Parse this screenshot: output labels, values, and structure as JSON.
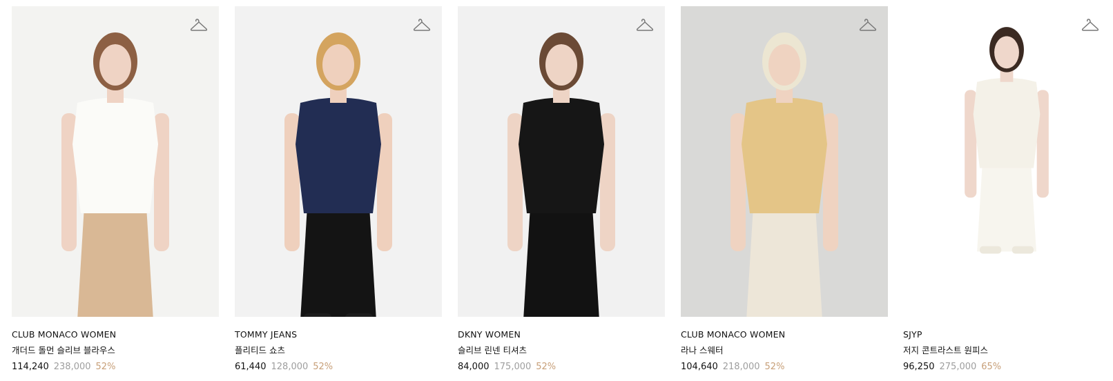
{
  "products": [
    {
      "brand": "CLUB MONACO WOMEN",
      "name": "개더드 돌먼 슬리브 블라우스",
      "price": "114,240",
      "original_price": "238,000",
      "discount": "52%",
      "photo": {
        "bg": "#f3f3f1",
        "top": "#fbfbf8",
        "bottom": "#d9b895",
        "hair": "#8d6044",
        "skin": "#efd3c4",
        "shoes": "#d9b895"
      },
      "icon": "hanger-icon"
    },
    {
      "brand": "TOMMY JEANS",
      "name": "플리티드 쇼츠",
      "price": "61,440",
      "original_price": "128,000",
      "discount": "52%",
      "photo": {
        "bg": "#f2f2f2",
        "top": "#222d53",
        "bottom": "#141414",
        "hair": "#d4a45f",
        "skin": "#efd0bd",
        "shoes": "#1d1d1d"
      },
      "icon": "hanger-icon"
    },
    {
      "brand": "DKNY WOMEN",
      "name": "슬리브 린넨 티셔츠",
      "price": "84,000",
      "original_price": "175,000",
      "discount": "52%",
      "photo": {
        "bg": "#f1f1f1",
        "top": "#161616",
        "bottom": "#121212",
        "hair": "#6b4a35",
        "skin": "#eed4c5",
        "shoes": "#121212"
      },
      "icon": "hanger-icon"
    },
    {
      "brand": "CLUB MONACO WOMEN",
      "name": "라나 스웨터",
      "price": "104,640",
      "original_price": "218,000",
      "discount": "52%",
      "photo": {
        "bg": "#d9d9d7",
        "top": "#e4c587",
        "bottom": "#ede6d8",
        "hair": "#ece6d2",
        "skin": "#efd3c1",
        "shoes": "#ede6d8"
      },
      "icon": "hanger-icon"
    },
    {
      "brand": "SJYP",
      "name": "저지 콘트라스트 원피스",
      "price": "96,250",
      "original_price": "275,000",
      "discount": "65%",
      "photo": {
        "bg": "#ffffff",
        "top": "#f4f1e8",
        "bottom": "#f7f5ee",
        "hair": "#3b2a22",
        "skin": "#efd7cb",
        "shoes": "#ece8dc"
      },
      "icon": "hanger-icon"
    }
  ]
}
